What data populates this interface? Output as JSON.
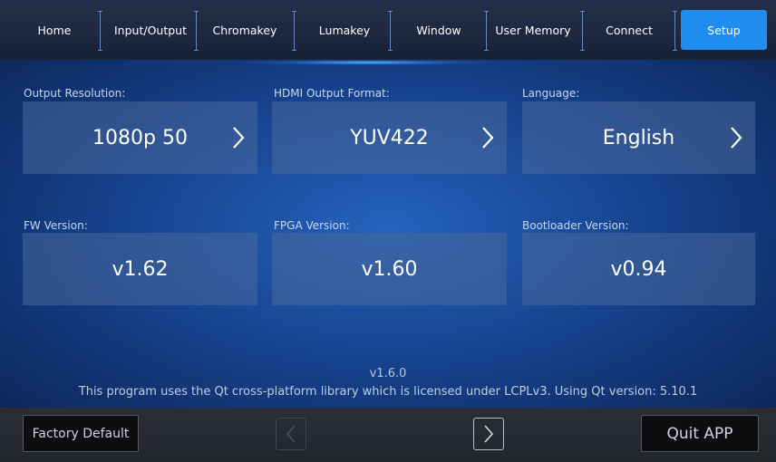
{
  "tabs": [
    {
      "label": "Home"
    },
    {
      "label": "Input/Output"
    },
    {
      "label": "Chromakey"
    },
    {
      "label": "Lumakey"
    },
    {
      "label": "Window"
    },
    {
      "label": "User Memory"
    },
    {
      "label": "Connect"
    },
    {
      "label": "Setup",
      "active": true
    }
  ],
  "settings": {
    "output_resolution": {
      "label": "Output Resolution:",
      "value": "1080p 50"
    },
    "hdmi_output_format": {
      "label": "HDMI Output Format:",
      "value": "YUV422"
    },
    "language": {
      "label": "Language:",
      "value": "English"
    },
    "fw_version": {
      "label": "FW Version:",
      "value": "v1.62"
    },
    "fpga_version": {
      "label": "FPGA Version:",
      "value": "v1.60"
    },
    "bootloader_version": {
      "label": "Bootloader Version:",
      "value": "v0.94"
    }
  },
  "footer": {
    "version": "v1.6.0",
    "license": "This program uses the Qt cross-platform library which is licensed under LCPLv3. Using Qt version: 5.10.1"
  },
  "bottom": {
    "factory_default": "Factory Default",
    "quit": "Quit APP",
    "prev_enabled": false,
    "next_enabled": true
  },
  "colors": {
    "accent": "#1f8cf0",
    "tile": "#48689a",
    "background": "#16418b"
  },
  "icons": {
    "chevron": "chevron-right-icon",
    "prev": "arrow-left-icon",
    "next": "arrow-right-icon"
  }
}
